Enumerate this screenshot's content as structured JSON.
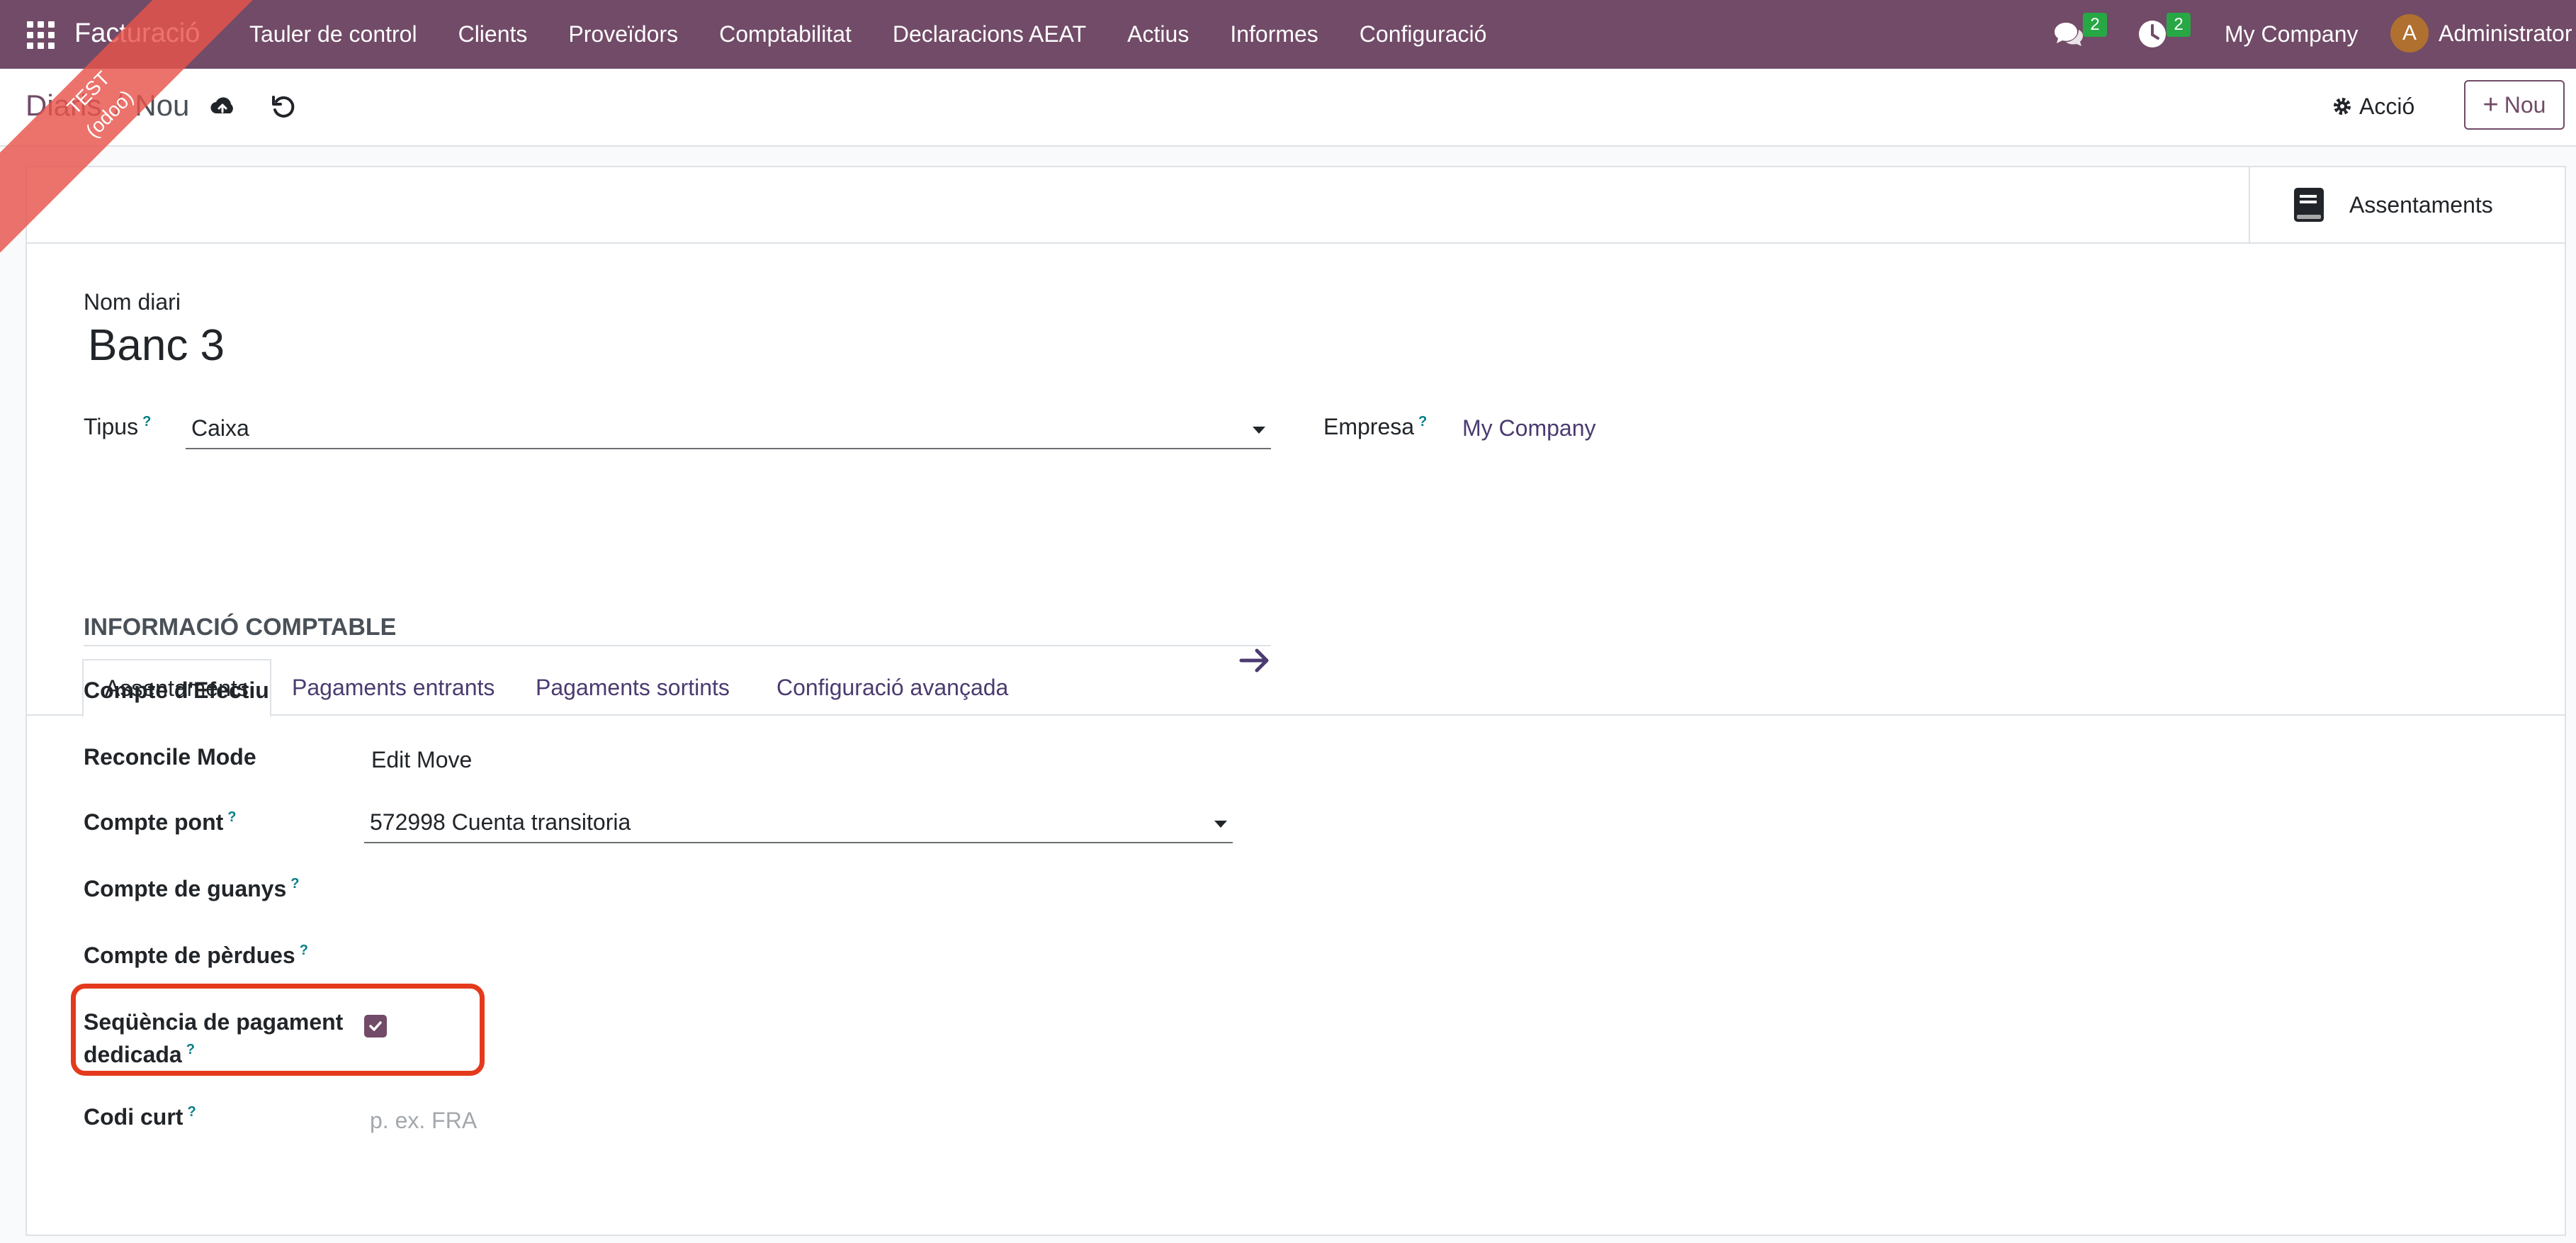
{
  "navbar": {
    "app_name": "Facturació",
    "menu": [
      "Tauler de control",
      "Clients",
      "Proveïdors",
      "Comptabilitat",
      "Declaracions AEAT",
      "Actius",
      "Informes",
      "Configuració"
    ],
    "messages_count": "2",
    "activities_count": "2",
    "company": "My Company",
    "user_initial": "A",
    "user_name": "Administrator"
  },
  "ribbon": {
    "line1": "TEST",
    "line2": "(odoo)"
  },
  "control_panel": {
    "breadcrumb_parent": "Diaris",
    "breadcrumb_separator": "/",
    "breadcrumb_current": "Nou",
    "action_label": "Acció",
    "new_label": "Nou"
  },
  "smart_button": {
    "label": "Assentaments"
  },
  "form": {
    "name_label": "Nom diari",
    "name_value": "Banc 3",
    "type_label": "Tipus",
    "type_value": "Caixa",
    "company_label": "Empresa",
    "company_value": "My Company",
    "help_mark": "?"
  },
  "tabs": [
    "Assentaments",
    "Pagaments entrants",
    "Pagaments sortints",
    "Configuració avançada"
  ],
  "accounting": {
    "title": "INFORMACIÓ COMPTABLE",
    "cash_account_label": "Compte d'Efectiu",
    "reconcile_mode_label": "Reconcile Mode",
    "reconcile_mode_value": "Edit Move",
    "bridge_account_label": "Compte pont",
    "bridge_account_value": "572998 Cuenta transitoria",
    "profit_account_label": "Compte de guanys",
    "loss_account_label": "Compte de pèrdues",
    "dedicated_sequence_label_1": "Seqüència de pagament",
    "dedicated_sequence_label_2": "dedicada",
    "dedicated_sequence_checked": true,
    "short_code_label": "Codi curt",
    "short_code_placeholder": "p. ex. FRA"
  },
  "colors": {
    "navbar": "#714b67",
    "link": "#4b3b70",
    "help": "#017e84",
    "highlight": "#e43a1c",
    "badge": "#28a745"
  }
}
